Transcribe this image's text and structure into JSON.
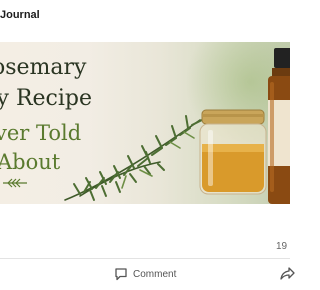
{
  "header": {
    "page_name": "Journal"
  },
  "post_image": {
    "headline_lines": [
      "osemary",
      "ry Recipe",
      "ver Told",
      "About"
    ],
    "colors": {
      "title": "#2a3522",
      "accent": "#5a7a2e",
      "oil": "#d99a2b",
      "lid": "#c9a55a"
    }
  },
  "stats": {
    "reaction_count": "19"
  },
  "actions": {
    "comment_label": "Comment",
    "comment_icon": "speech-bubble-icon",
    "share_icon": "share-arrow-icon"
  }
}
